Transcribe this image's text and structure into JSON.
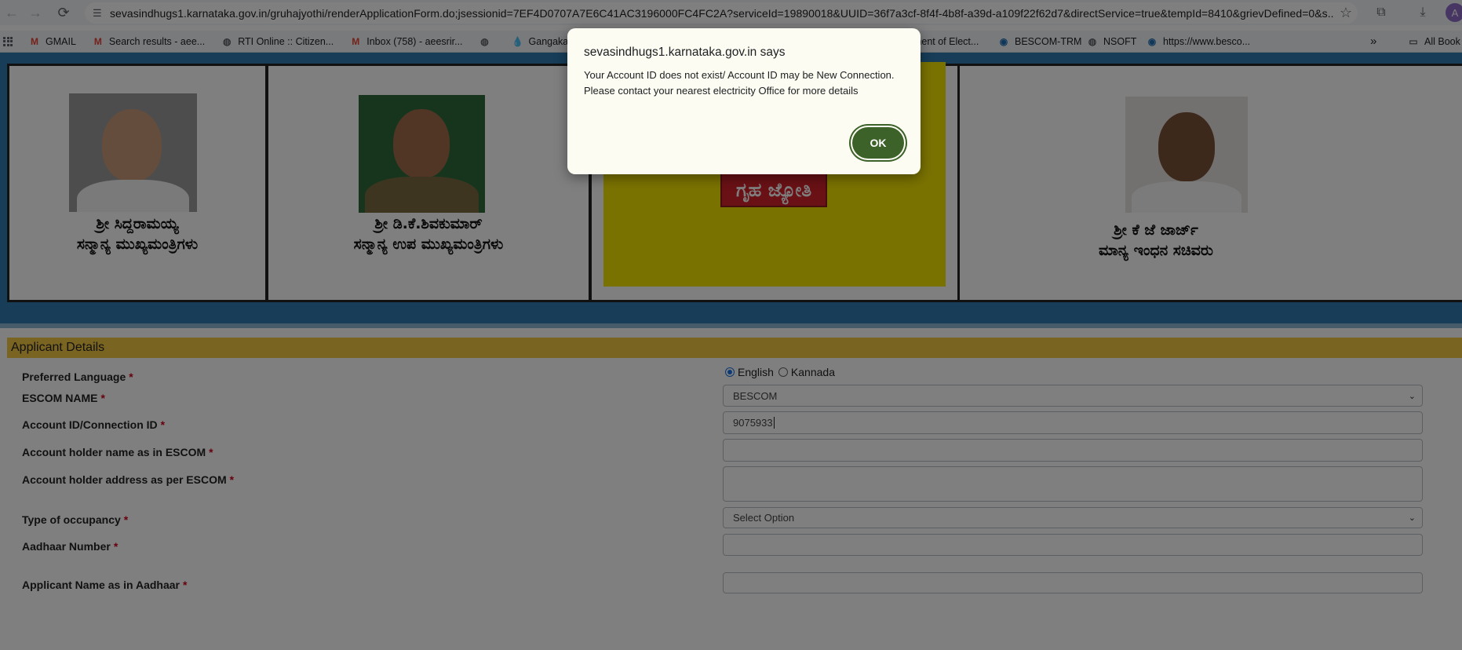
{
  "browser": {
    "url": "sevasindhugs1.karnataka.gov.in/gruhajyothi/renderApplicationForm.do;jsessionid=7EF4D0707A7E6C41AC3196000FC4FC2A?serviceId=19890018&UUID=36f7a3cf-8f4f-4b8f-a39d-a109f22f62d7&directService=true&tempId=8410&grievDefined=0&s...",
    "avatar_letter": "A",
    "bookmarks": [
      {
        "label": "GMAIL",
        "icon": "gmail-icon"
      },
      {
        "label": "Search results - aee...",
        "icon": "gmail-icon"
      },
      {
        "label": "RTI Online :: Citizen...",
        "icon": "globe-icon"
      },
      {
        "label": "Inbox (758) - aeesrir...",
        "icon": "gmail-icon"
      },
      {
        "label": "",
        "icon": "globe-icon"
      },
      {
        "label": "Gangakalyana",
        "icon": "drop-icon"
      },
      {
        "label": "ement of Elect...",
        "icon": ""
      },
      {
        "label": "BESCOM-TRM",
        "icon": "bescom-icon"
      },
      {
        "label": "NSOFT",
        "icon": "globe-icon"
      },
      {
        "label": "https://www.besco...",
        "icon": "bescom-icon"
      }
    ],
    "more_bookmarks": "»",
    "all_bookmarks": "All Book"
  },
  "banner": {
    "captions": [
      {
        "line1": "ಶ್ರೀ ಸಿದ್ದರಾಮಯ್ಯ",
        "line2": "ಸನ್ಮಾನ್ಯ ಮುಖ್ಯಮಂತ್ರಿಗಳು"
      },
      {
        "line1": "ಶ್ರೀ ಡಿ.ಕೆ.ಶಿವಕುಮಾರ್",
        "line2": "ಸನ್ಮಾನ್ಯ ಉಪ ಮುಖ್ಯಮಂತ್ರಿಗಳು"
      },
      {
        "line1": "ಶ್ರೀ ಕೆ ಜೆ ಜಾರ್ಜ್",
        "line2": "ಮಾನ್ಯ ಇಂಧನ ಸಚಿವರು"
      }
    ],
    "logo_text": "ಗೃಹ ಜ್ಯೋತಿ"
  },
  "form": {
    "section_title": "Applicant Details",
    "preferred_language": {
      "label": "Preferred Language",
      "options": [
        "English",
        "Kannada"
      ],
      "selected": "English"
    },
    "escom_name": {
      "label": "ESCOM NAME",
      "value": "BESCOM"
    },
    "account_id": {
      "label": "Account ID/Connection ID",
      "value": "9075933"
    },
    "holder_name": {
      "label": "Account holder name as in ESCOM",
      "value": ""
    },
    "holder_address": {
      "label": "Account holder address as per ESCOM",
      "value": ""
    },
    "occupancy": {
      "label": "Type of occupancy",
      "value": "Select Option"
    },
    "aadhaar": {
      "label": "Aadhaar Number",
      "value": ""
    },
    "applicant_name": {
      "label": "Applicant Name as in Aadhaar",
      "value": ""
    },
    "required_mark": "*"
  },
  "dialog": {
    "title": "sevasindhugs1.karnataka.gov.in says",
    "message_line1": "Your Account ID does not exist/ Account ID may be New Connection.",
    "message_line2": "Please contact your nearest electricity Office for more details",
    "ok_label": "OK"
  }
}
